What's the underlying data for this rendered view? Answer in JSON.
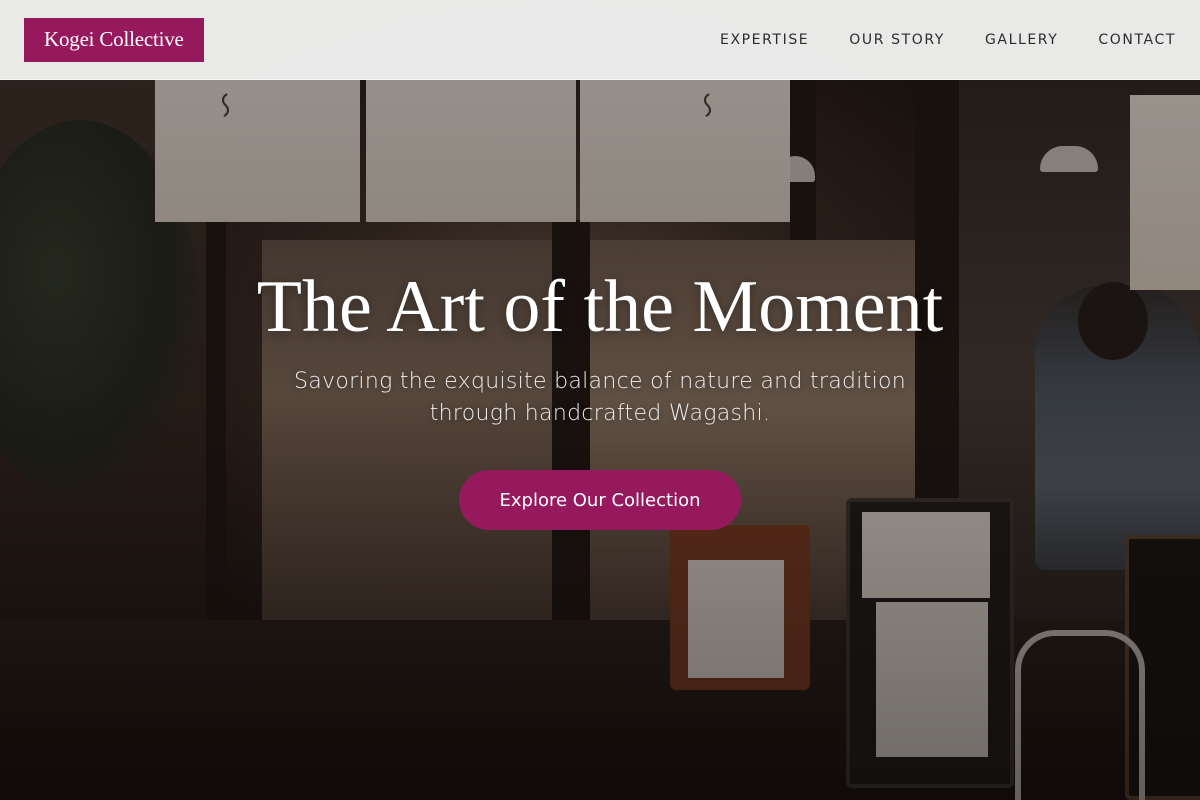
{
  "header": {
    "logo_text": "Kogei Collective",
    "nav": [
      {
        "label": "EXPERTISE"
      },
      {
        "label": "OUR STORY"
      },
      {
        "label": "GALLERY"
      },
      {
        "label": "CONTACT"
      }
    ]
  },
  "hero": {
    "title": "The Art of the Moment",
    "subtitle": "Savoring the exquisite balance of nature and tradition through handcrafted Wagashi.",
    "cta_label": "Explore Our Collection",
    "background_image": "photo of a Japanese restaurant storefront at night with noren curtains"
  },
  "colors": {
    "accent": "#96195e",
    "header_bg": "#f7f7f7",
    "nav_text": "#2c2c2c",
    "hero_text": "#ffffff"
  }
}
